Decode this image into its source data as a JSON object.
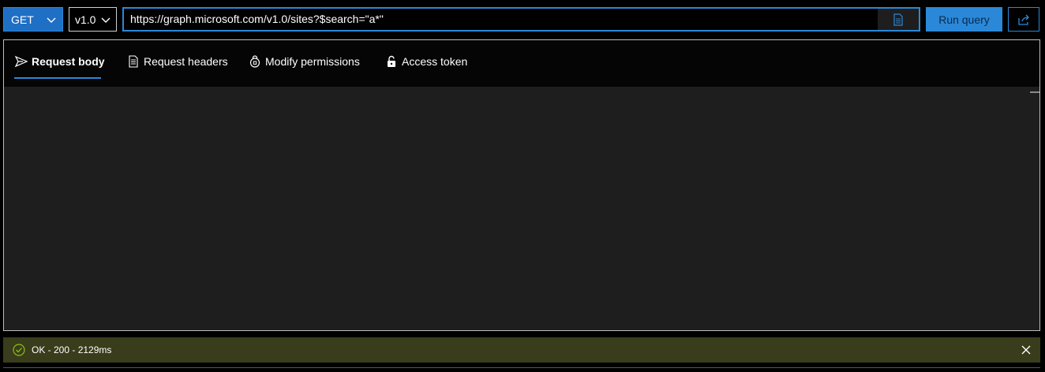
{
  "query": {
    "method": "GET",
    "version": "v1.0",
    "url": "https://graph.microsoft.com/v1.0/sites?$search=\"a*\"",
    "run_label": "Run query"
  },
  "tabs": [
    {
      "label": "Request body",
      "icon": "send-icon",
      "active": true
    },
    {
      "label": "Request headers",
      "icon": "document-list-icon",
      "active": false
    },
    {
      "label": "Modify permissions",
      "icon": "lock-shield-icon",
      "active": false
    },
    {
      "label": "Access token",
      "icon": "unlock-icon",
      "active": false
    }
  ],
  "status": {
    "text": "OK - 200 - 2129ms",
    "icon": "check-circle-icon",
    "color": "#393d1b"
  },
  "colors": {
    "accent": "#2b88d8",
    "editor_bg": "#1e1e1e",
    "success_bg": "#393d1b"
  }
}
